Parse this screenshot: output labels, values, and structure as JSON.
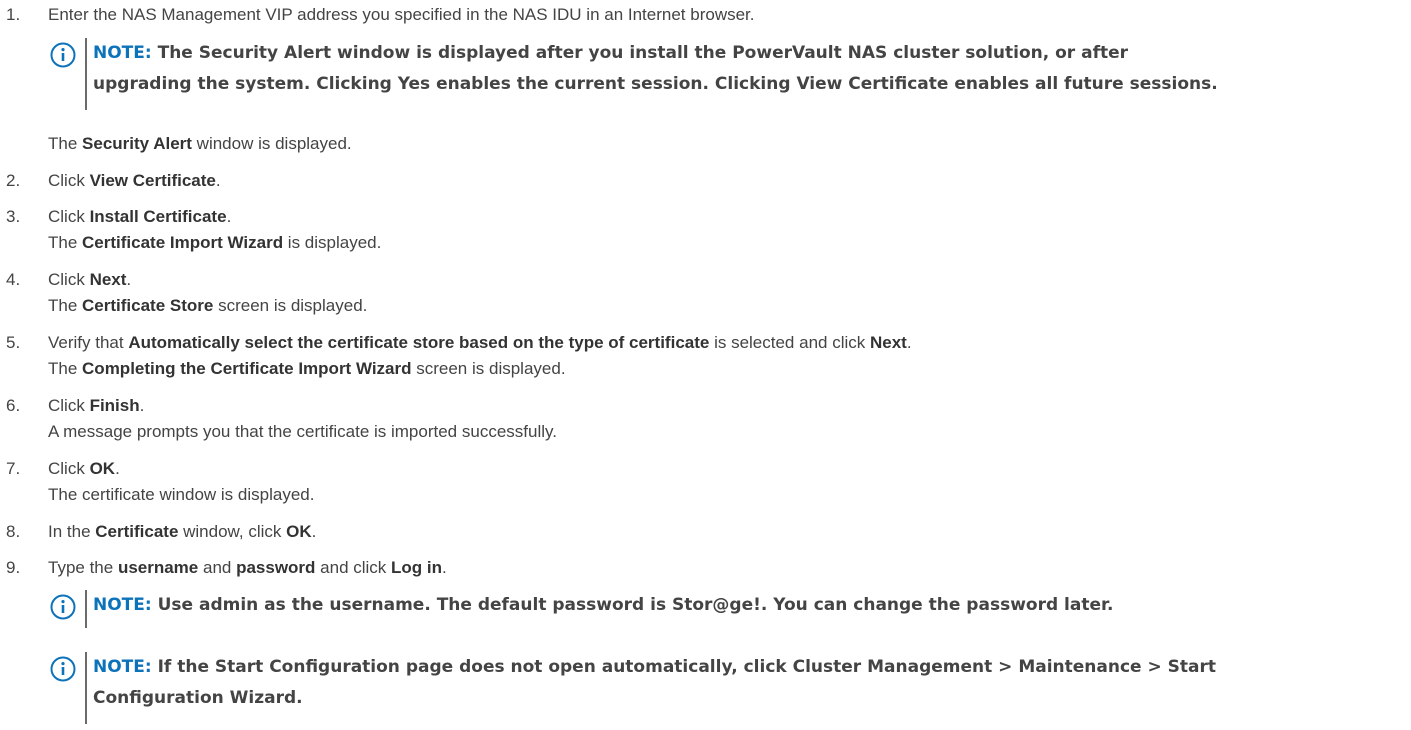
{
  "steps": [
    {
      "num": "1.",
      "segments": [
        {
          "t": "Enter the NAS Management VIP address you specified in the NAS IDU in an Internet browser.",
          "b": false
        }
      ]
    },
    {
      "num": "",
      "segments": [
        {
          "t": "The ",
          "b": false
        },
        {
          "t": "Security Alert",
          "b": true
        },
        {
          "t": " window is displayed.",
          "b": false
        }
      ]
    },
    {
      "num": "2.",
      "segments": [
        {
          "t": "Click ",
          "b": false
        },
        {
          "t": "View Certificate",
          "b": true
        },
        {
          "t": ".",
          "b": false
        }
      ]
    },
    {
      "num": "3.",
      "segments": [
        {
          "t": "Click ",
          "b": false
        },
        {
          "t": "Install Certificate",
          "b": true
        },
        {
          "t": ".",
          "b": false
        }
      ]
    },
    {
      "num": "",
      "segments": [
        {
          "t": "The ",
          "b": false
        },
        {
          "t": "Certificate Import Wizard",
          "b": true
        },
        {
          "t": " is displayed.",
          "b": false
        }
      ]
    },
    {
      "num": "4.",
      "segments": [
        {
          "t": "Click ",
          "b": false
        },
        {
          "t": "Next",
          "b": true
        },
        {
          "t": ".",
          "b": false
        }
      ]
    },
    {
      "num": "",
      "segments": [
        {
          "t": "The ",
          "b": false
        },
        {
          "t": "Certificate Store",
          "b": true
        },
        {
          "t": " screen is displayed.",
          "b": false
        }
      ]
    },
    {
      "num": "5.",
      "segments": [
        {
          "t": "Verify that ",
          "b": false
        },
        {
          "t": "Automatically select the certificate store based on the type of certificate",
          "b": true
        },
        {
          "t": " is selected and click ",
          "b": false
        },
        {
          "t": "Next",
          "b": true
        },
        {
          "t": ".",
          "b": false
        }
      ]
    },
    {
      "num": "",
      "segments": [
        {
          "t": "The ",
          "b": false
        },
        {
          "t": "Completing the Certificate Import Wizard",
          "b": true
        },
        {
          "t": " screen is displayed.",
          "b": false
        }
      ]
    },
    {
      "num": "6.",
      "segments": [
        {
          "t": "Click ",
          "b": false
        },
        {
          "t": "Finish",
          "b": true
        },
        {
          "t": ".",
          "b": false
        }
      ]
    },
    {
      "num": "",
      "segments": [
        {
          "t": "A message prompts you that the certificate is imported successfully.",
          "b": false
        }
      ]
    },
    {
      "num": "7.",
      "segments": [
        {
          "t": "Click ",
          "b": false
        },
        {
          "t": "OK",
          "b": true
        },
        {
          "t": ".",
          "b": false
        }
      ]
    },
    {
      "num": "",
      "segments": [
        {
          "t": "The certificate window is displayed.",
          "b": false
        }
      ]
    },
    {
      "num": "8.",
      "segments": [
        {
          "t": "In the ",
          "b": false
        },
        {
          "t": "Certificate",
          "b": true
        },
        {
          "t": " window, click ",
          "b": false
        },
        {
          "t": "OK",
          "b": true
        },
        {
          "t": ".",
          "b": false
        }
      ]
    },
    {
      "num": "9.",
      "segments": [
        {
          "t": "Type the ",
          "b": false
        },
        {
          "t": "username",
          "b": true
        },
        {
          "t": " and ",
          "b": false
        },
        {
          "t": "password",
          "b": true
        },
        {
          "t": " and click ",
          "b": false
        },
        {
          "t": "Log in",
          "b": true
        },
        {
          "t": ".",
          "b": false
        }
      ]
    }
  ],
  "notes": [
    {
      "label": "NOTE:",
      "lines": [
        " The Security Alert window is displayed after you install the PowerVault NAS cluster solution, or after",
        "upgrading the system. Clicking Yes enables the current session. Clicking View Certificate enables all future sessions."
      ]
    },
    {
      "label": "NOTE:",
      "lines": [
        " Use admin as the username. The default password is Stor@ge!. You can change the password later."
      ]
    },
    {
      "label": "NOTE:",
      "lines": [
        " If the Start Configuration page does not open automatically, click Cluster Management > Maintenance > Start",
        "Configuration Wizard."
      ]
    }
  ],
  "colors": {
    "note_label": "#0c72ba",
    "icon": "#0c72ba",
    "text": "#444444"
  },
  "icons": {
    "note": "info-icon"
  }
}
